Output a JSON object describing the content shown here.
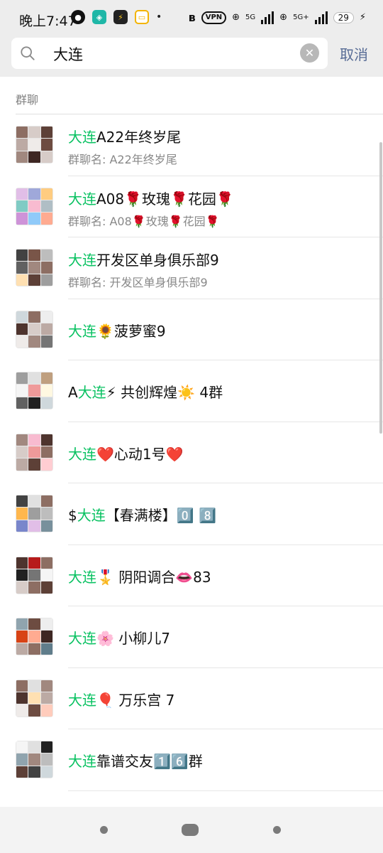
{
  "status_bar": {
    "time": "晚上7:47",
    "vpn": "VPN",
    "net1": "5G",
    "net2": "5G+",
    "battery": "29"
  },
  "search": {
    "query": "大连",
    "cancel_label": "取消"
  },
  "section": {
    "label": "群聊"
  },
  "results": [
    {
      "highlight_pre": "",
      "highlight": "大连",
      "rest": "A22年终岁尾",
      "subtitle": "群聊名: A22年终岁尾"
    },
    {
      "highlight_pre": "",
      "highlight": "大连",
      "rest": "A08🌹玫瑰🌹花园🌹",
      "subtitle": "群聊名: A08🌹玫瑰🌹花园🌹"
    },
    {
      "highlight_pre": "",
      "highlight": "大连",
      "rest": "开发区单身俱乐部9",
      "subtitle": "群聊名: 开发区单身俱乐部9"
    },
    {
      "highlight_pre": "",
      "highlight": "大连",
      "rest": "🌻菠萝蜜9",
      "subtitle": ""
    },
    {
      "highlight_pre": "A",
      "highlight": "大连",
      "rest": "⚡ 共创辉煌☀️ 4群",
      "subtitle": ""
    },
    {
      "highlight_pre": "",
      "highlight": "大连",
      "rest": "❤️心动1号❤️",
      "subtitle": ""
    },
    {
      "highlight_pre": "$",
      "highlight": "大连",
      "rest": "【春满楼】0️⃣ 8️⃣",
      "subtitle": ""
    },
    {
      "highlight_pre": "",
      "highlight": "大连",
      "rest": "🎖️ 阴阳调合👄83",
      "subtitle": ""
    },
    {
      "highlight_pre": "",
      "highlight": "大连",
      "rest": "🌸 小柳儿7",
      "subtitle": ""
    },
    {
      "highlight_pre": "",
      "highlight": "大连",
      "rest": "🎈 万乐宫 7",
      "subtitle": ""
    },
    {
      "highlight_pre": "",
      "highlight": "大连",
      "rest": "靠谱交友1️⃣6️⃣群",
      "subtitle": ""
    }
  ],
  "colors": {
    "highlight": "#07c160",
    "cancel": "#576b95",
    "topbar_bg": "#ededed"
  }
}
